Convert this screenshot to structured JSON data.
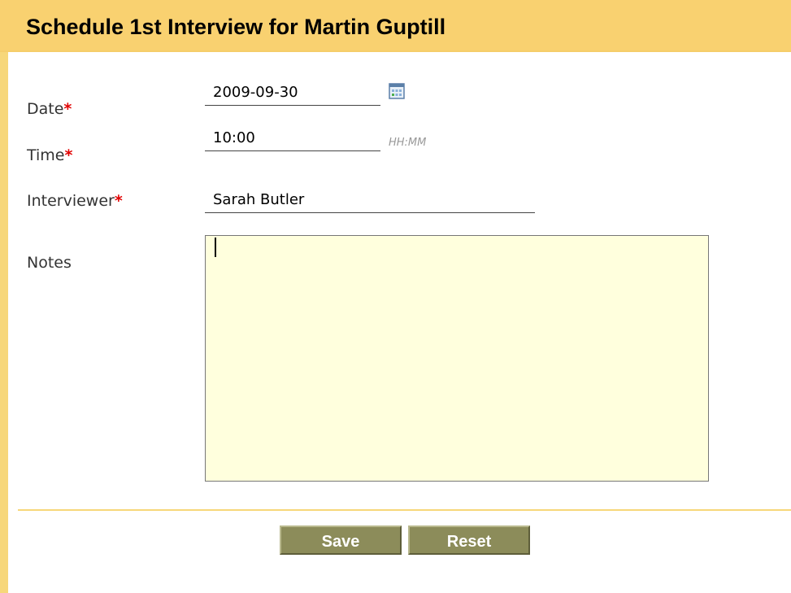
{
  "header": {
    "title": "Schedule 1st Interview for Martin Guptill"
  },
  "form": {
    "date": {
      "label": "Date",
      "required_marker": "*",
      "value": "2009-09-30",
      "icon": "calendar-icon"
    },
    "time": {
      "label": "Time",
      "required_marker": "*",
      "value": "10:00",
      "hint": "HH:MM"
    },
    "interviewer": {
      "label": "Interviewer",
      "required_marker": "*",
      "value": "Sarah Butler"
    },
    "notes": {
      "label": "Notes",
      "value": ""
    }
  },
  "buttons": {
    "save_label": "Save",
    "reset_label": "Reset"
  },
  "colors": {
    "header_bg": "#f9d170",
    "button_bg": "#8c8c5a",
    "notes_bg": "#ffffdd",
    "required": "#e10000"
  }
}
